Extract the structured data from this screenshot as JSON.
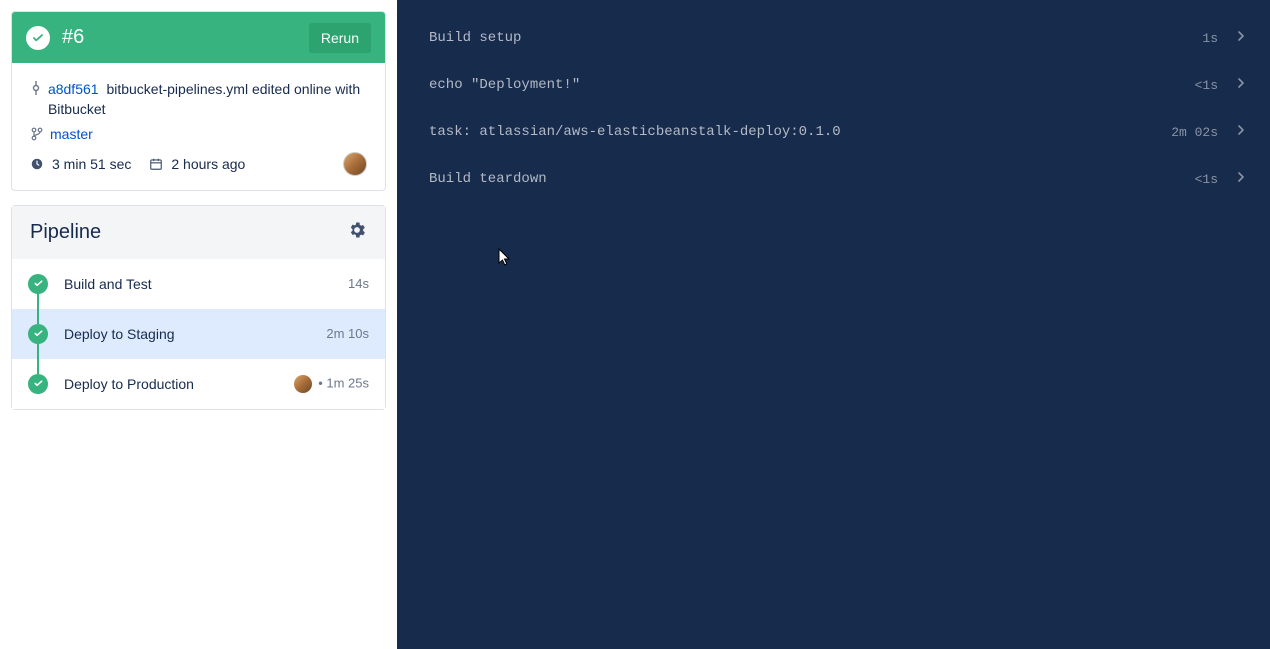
{
  "build": {
    "number": "#6",
    "rerun_label": "Rerun",
    "commit_hash": "a8df561",
    "commit_message": "bitbucket-pipelines.yml edited online with Bitbucket",
    "branch": "master",
    "duration": "3 min 51 sec",
    "relative_time": "2 hours ago"
  },
  "pipeline": {
    "title": "Pipeline",
    "steps": [
      {
        "name": "Build and Test",
        "time": "14s",
        "selected": false,
        "manual": false
      },
      {
        "name": "Deploy to Staging",
        "time": "2m 10s",
        "selected": true,
        "manual": false
      },
      {
        "name": "Deploy to Production",
        "time": "1m 25s",
        "selected": false,
        "manual": true
      }
    ]
  },
  "log": [
    {
      "text": "Build setup",
      "time": "1s"
    },
    {
      "text": "echo \"Deployment!\"",
      "time": "<1s"
    },
    {
      "text": "task: atlassian/aws-elasticbeanstalk-deploy:0.1.0",
      "time": "2m 02s"
    },
    {
      "text": "Build teardown",
      "time": "<1s"
    }
  ]
}
